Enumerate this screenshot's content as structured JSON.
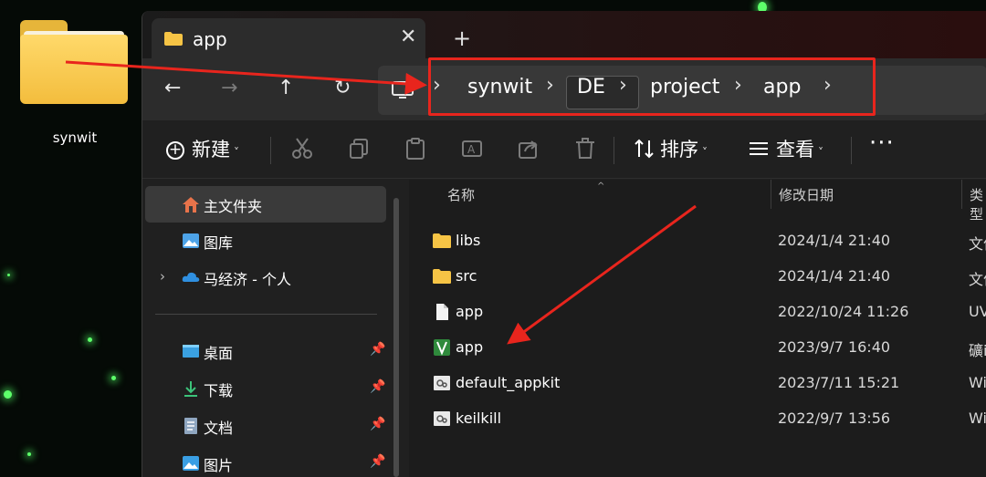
{
  "desktop": {
    "folder_label": "synwit"
  },
  "window": {
    "tab_title": "app",
    "tab_close": "✕",
    "new_tab": "+",
    "nav": {
      "back": "←",
      "forward": "→",
      "up": "↑",
      "refresh": "↻"
    },
    "breadcrumb": [
      "synwit",
      "DE",
      "project",
      "app"
    ],
    "chevron": "›"
  },
  "toolbar": {
    "new_label": "新建",
    "sort_label": "排序",
    "view_label": "查看",
    "more": "···",
    "dropdown": "˅"
  },
  "sidebar": {
    "items": [
      {
        "label": "主文件夹",
        "icon": "home-icon"
      },
      {
        "label": "图库",
        "icon": "gallery-icon"
      },
      {
        "label": "马经济 - 个人",
        "icon": "onedrive-cloud-icon"
      },
      {
        "label": "桌面",
        "icon": "desktop-icon"
      },
      {
        "label": "下载",
        "icon": "download-icon"
      },
      {
        "label": "文档",
        "icon": "document-icon"
      },
      {
        "label": "图片",
        "icon": "pictures-icon"
      }
    ],
    "expander": "›",
    "pin": "📌"
  },
  "filelist": {
    "columns": {
      "name": "名称",
      "date": "修改日期",
      "type": "类型"
    },
    "sort_caret": "^",
    "rows": [
      {
        "name": "libs",
        "date": "2024/1/4 21:40",
        "type": "文件夹",
        "icon": "folder-icon"
      },
      {
        "name": "src",
        "date": "2024/1/4 21:40",
        "type": "文件夹",
        "icon": "folder-icon"
      },
      {
        "name": "app",
        "date": "2022/10/24 11:26",
        "type": "UV",
        "icon": "file-icon"
      },
      {
        "name": "app",
        "date": "2023/9/7 16:40",
        "type": "礦i",
        "icon": "keil-project-icon"
      },
      {
        "name": "default_appkit",
        "date": "2023/7/11 15:21",
        "type": "Wi",
        "icon": "batch-file-icon"
      },
      {
        "name": "keilkill",
        "date": "2022/9/7 13:56",
        "type": "Wi",
        "icon": "batch-file-icon"
      }
    ]
  },
  "colors": {
    "annotation_red": "#e8251d",
    "window_bg": "#202020",
    "folder_yellow": "#f3bd3d"
  }
}
